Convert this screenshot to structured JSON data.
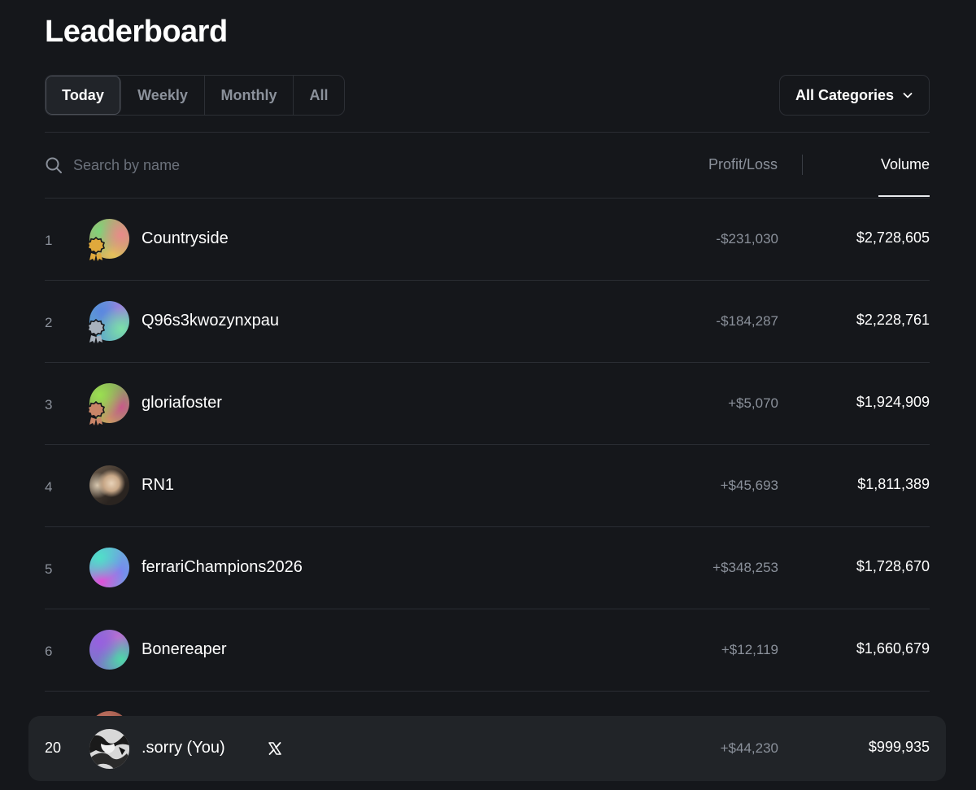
{
  "page": {
    "title": "Leaderboard"
  },
  "period_tabs": [
    {
      "label": "Today",
      "active": true
    },
    {
      "label": "Weekly",
      "active": false
    },
    {
      "label": "Monthly",
      "active": false
    },
    {
      "label": "All",
      "active": false
    }
  ],
  "category_dropdown": {
    "label": "All Categories",
    "icon": "chevron-down-icon"
  },
  "search": {
    "placeholder": "Search by name",
    "value": "",
    "icon": "search-icon"
  },
  "sort": {
    "profit_loss_label": "Profit/Loss",
    "volume_label": "Volume",
    "active": "Volume"
  },
  "rows": [
    {
      "rank": "1",
      "name": "Countryside",
      "profit_loss": "-$231,030",
      "volume": "$2,728,605",
      "medal": "gold",
      "medal_color": "#e0a93c",
      "avatar": "gradient-avatar"
    },
    {
      "rank": "2",
      "name": "Q96s3kwozynxpau",
      "profit_loss": "-$184,287",
      "volume": "$2,228,761",
      "medal": "silver",
      "medal_color": "#a9b2bd",
      "avatar": "gradient-avatar"
    },
    {
      "rank": "3",
      "name": "gloriafoster",
      "profit_loss": "+$5,070",
      "volume": "$1,924,909",
      "medal": "bronze",
      "medal_color": "#c98568",
      "avatar": "gradient-avatar"
    },
    {
      "rank": "4",
      "name": "RN1",
      "profit_loss": "+$45,693",
      "volume": "$1,811,389",
      "medal": null,
      "avatar": "photo-avatar"
    },
    {
      "rank": "5",
      "name": "ferrariChampions2026",
      "profit_loss": "+$348,253",
      "volume": "$1,728,670",
      "medal": null,
      "avatar": "gradient-avatar"
    },
    {
      "rank": "6",
      "name": "Bonereaper",
      "profit_loss": "+$12,119",
      "volume": "$1,660,679",
      "medal": null,
      "avatar": "gradient-avatar"
    }
  ],
  "current_user": {
    "rank": "20",
    "name": ".sorry (You)",
    "profit_loss": "+$44,230",
    "volume": "$999,935",
    "social_icon": "x-logo-icon",
    "avatar": "photo-avatar"
  },
  "colors": {
    "background": "#15171b",
    "text_primary": "#ffffff",
    "text_muted": "#8b919b",
    "border": "#2a2d33",
    "sticky_row_bg": "#212428"
  }
}
